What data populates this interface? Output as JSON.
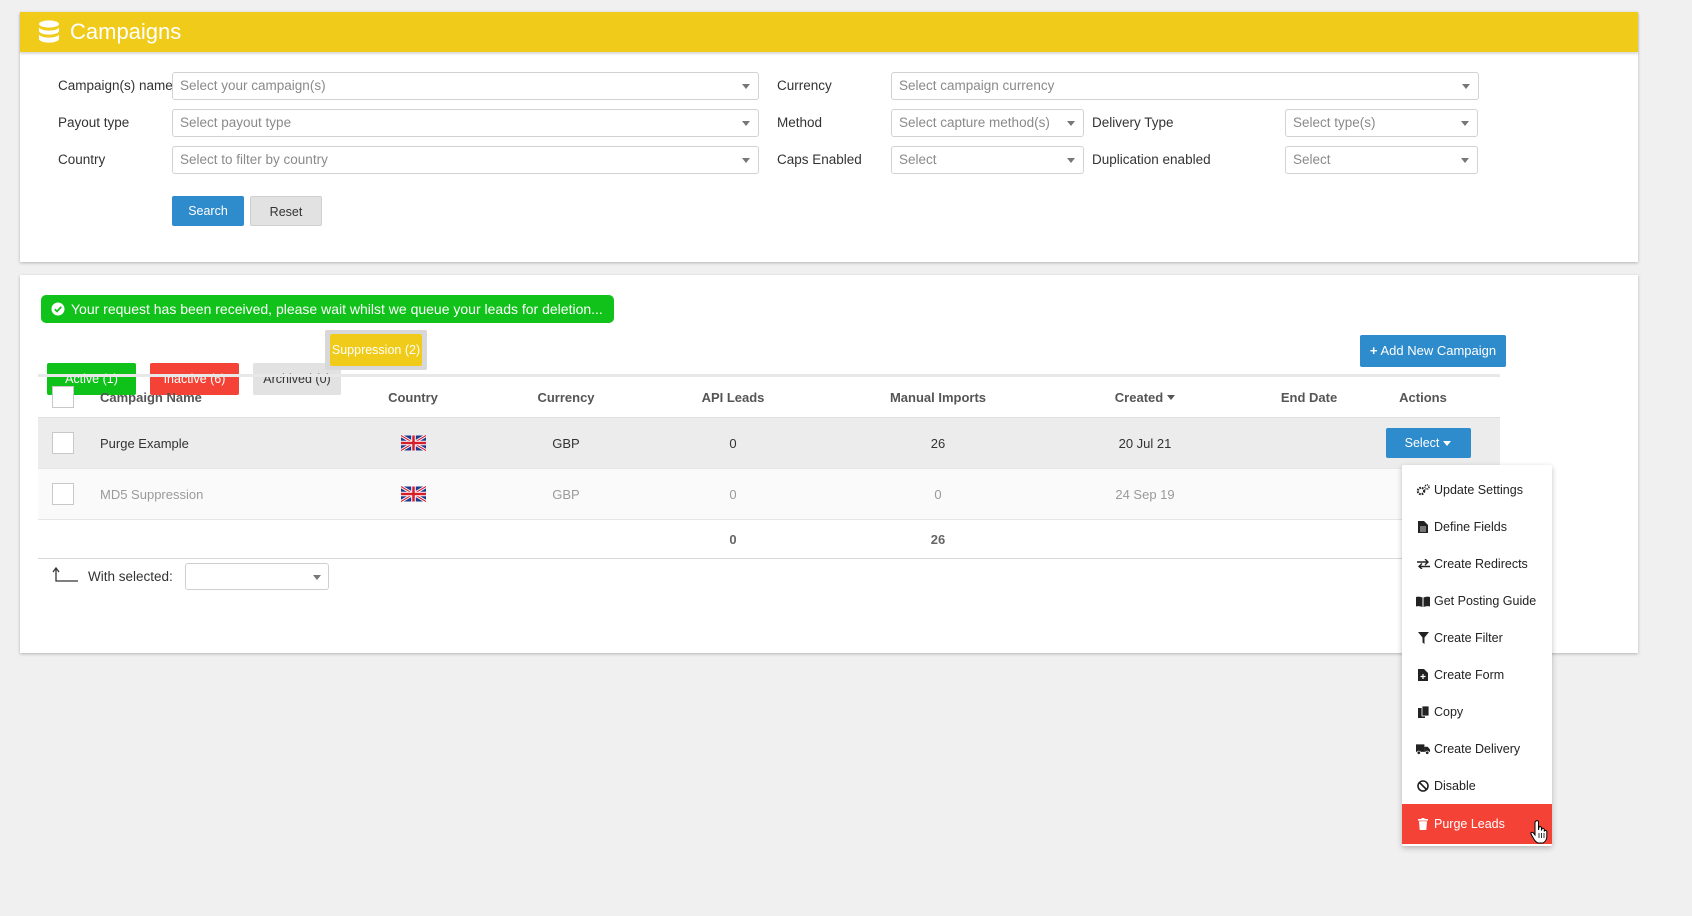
{
  "header": {
    "title": "Campaigns",
    "icon": "database-icon"
  },
  "filters": {
    "campaign_name": {
      "label": "Campaign(s) name",
      "placeholder": "Select your campaign(s)"
    },
    "payout_type": {
      "label": "Payout type",
      "placeholder": "Select payout type"
    },
    "country": {
      "label": "Country",
      "placeholder": "Select to filter by country"
    },
    "currency": {
      "label": "Currency",
      "placeholder": "Select campaign currency"
    },
    "method": {
      "label": "Method",
      "placeholder": "Select capture method(s)"
    },
    "caps_enabled": {
      "label": "Caps Enabled",
      "placeholder": "Select"
    },
    "delivery_type": {
      "label": "Delivery Type",
      "placeholder": "Select type(s)"
    },
    "duplication_enabled": {
      "label": "Duplication enabled",
      "placeholder": "Select"
    },
    "search_label": "Search",
    "reset_label": "Reset"
  },
  "alert": {
    "text": "Your request has been received, please wait whilst we queue your leads for deletion...",
    "color": "#10c21a"
  },
  "tabs": [
    {
      "label": "Active (1)",
      "color": "#0fc21a"
    },
    {
      "label": "Inactive (6)",
      "color": "#f44336"
    },
    {
      "label": "Archived (0)",
      "color": "#e2e2e2"
    },
    {
      "label": "Suppression (2)",
      "color": "#f1cb19"
    }
  ],
  "add_button": "Add New Campaign",
  "table": {
    "columns": [
      "Campaign Name",
      "Country",
      "Currency",
      "API Leads",
      "Manual Imports",
      "Created",
      "End Date",
      "Actions"
    ],
    "rows": [
      {
        "name": "Purge Example",
        "country": "uk-flag-icon",
        "currency": "GBP",
        "api_leads": "0",
        "manual_imports": "26",
        "created": "20 Jul 21",
        "end_date": "",
        "action": "Select"
      },
      {
        "name": "MD5 Suppression",
        "country": "uk-flag-icon",
        "currency": "GBP",
        "api_leads": "0",
        "manual_imports": "0",
        "created": "24 Sep 19",
        "end_date": ""
      }
    ],
    "totals": {
      "api_leads": "0",
      "manual_imports": "26"
    }
  },
  "with_selected": {
    "label": "With selected:"
  },
  "menu": {
    "items": [
      {
        "label": "Update Settings",
        "icon": "gears-icon"
      },
      {
        "label": "Define Fields",
        "icon": "file-icon"
      },
      {
        "label": "Create Redirects",
        "icon": "exchange-icon"
      },
      {
        "label": "Get Posting Guide",
        "icon": "book-icon"
      },
      {
        "label": "Create Filter",
        "icon": "filter-icon"
      },
      {
        "label": "Create Form",
        "icon": "file-plus-icon"
      },
      {
        "label": "Copy",
        "icon": "copy-icon"
      },
      {
        "label": "Create Delivery",
        "icon": "truck-icon"
      },
      {
        "label": "Disable",
        "icon": "ban-icon"
      },
      {
        "label": "Purge Leads",
        "icon": "trash-icon"
      }
    ]
  },
  "colors": {
    "brand": "#f1cb19",
    "primary": "#2e8bcc",
    "danger": "#f44336",
    "success": "#10c21a"
  }
}
